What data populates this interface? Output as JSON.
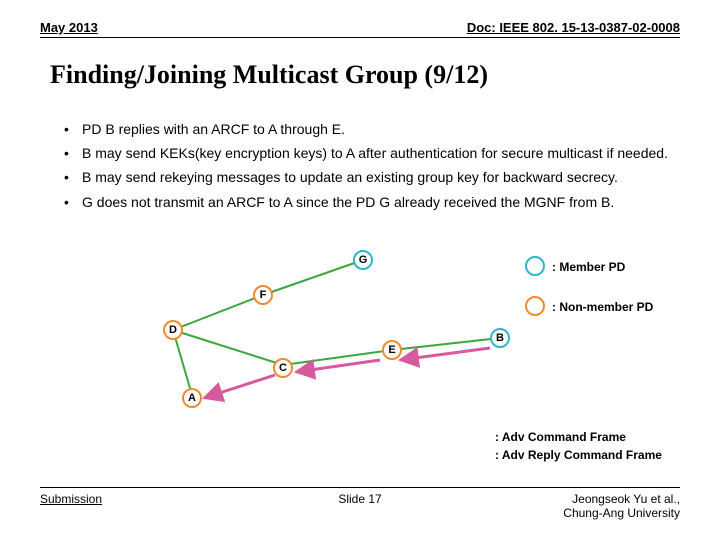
{
  "header": {
    "left": "May 2013",
    "right": "Doc: IEEE 802. 15-13-0387-02-0008"
  },
  "title": "Finding/Joining Multicast Group (9/12)",
  "bullets": [
    "PD B replies with an ARCF to A through E.",
    "B may send KEKs(key encryption keys) to A after authentication for secure multicast if needed.",
    "B may send rekeying messages to update an existing group key for backward secrecy.",
    "G does not transmit an ARCF to A since the PD G already received the MGNF from B."
  ],
  "nodes": {
    "G": "G",
    "F": "F",
    "D": "D",
    "C": "C",
    "E": "E",
    "B": "B",
    "A": "A"
  },
  "legend": {
    "member": ": Member PD",
    "nonmember": ": Non-member PD",
    "adv1": ": Adv Command Frame",
    "adv2": ": Adv Reply Command Frame"
  },
  "colors": {
    "member": "#2fb6c9",
    "nonmember": "#f08b2c",
    "arrowGreen": "#3da63d",
    "arrowBlue": "#3a6fd8",
    "arrowPink": "#d85a9e"
  },
  "footer": {
    "left": "Submission",
    "center": "Slide 17",
    "rightLine1": "Jeongseok Yu et al.,",
    "rightLine2": "Chung-Ang University"
  }
}
